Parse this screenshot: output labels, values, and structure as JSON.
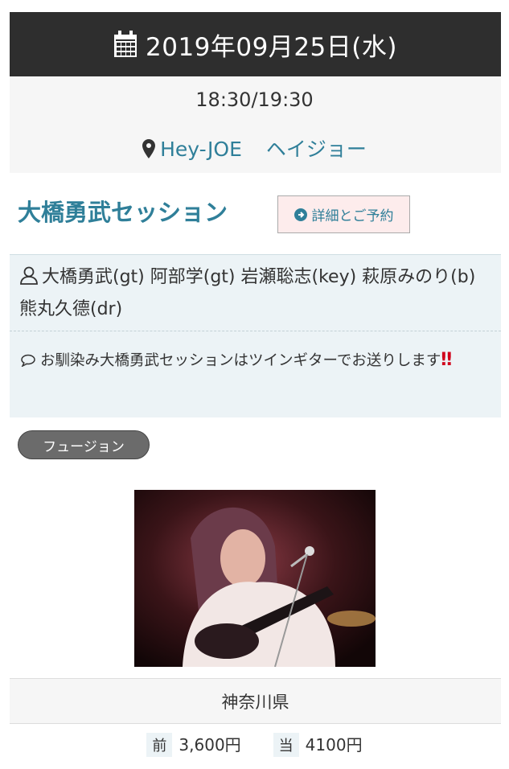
{
  "event": {
    "date": "2019年09月25日(水)",
    "time": "18:30/19:30",
    "venue": {
      "name": "Hey-JOE",
      "kana": "ヘイジョー"
    },
    "title": "大橋勇武セッション",
    "detail_button": "詳細とご予約",
    "members": "大橋勇武(gt) 阿部学(gt) 岩瀬聡志(key) 萩原みのり(b) 熊丸久德(dr)",
    "comment": "お馴染み大橋勇武セッションはツインギターでお送りします",
    "comment_mark": "‼",
    "genre": "フュージョン",
    "prefecture": "神奈川県",
    "price": {
      "advance_label": "前",
      "advance": "3,600円",
      "door_label": "当",
      "door": "4100円"
    }
  },
  "icons": {
    "date": "calendar-icon",
    "venue": "map-marker-icon",
    "detail": "arrow-circle-right-icon",
    "members": "user-icon",
    "comment": "speech-bubble-icon"
  },
  "colors": {
    "header_bg": "#2e2e2e",
    "accent": "#2f7f99",
    "info_bg": "#ecf3f6",
    "button_bg": "#fdecec",
    "tag_bg": "#6b6b6b",
    "exclaim": "#d0021b"
  }
}
